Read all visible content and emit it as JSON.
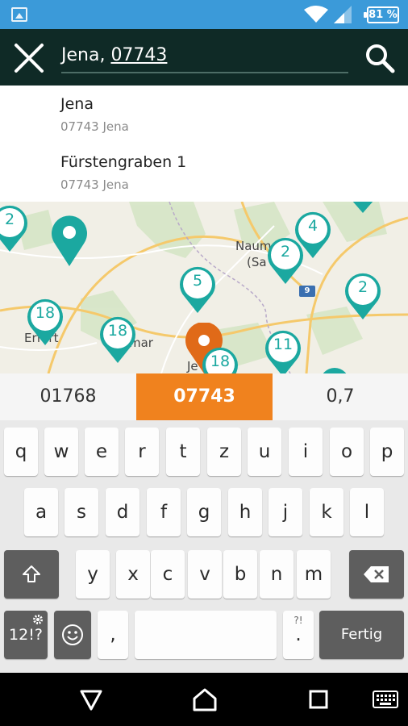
{
  "status_bar": {
    "battery": "81 %"
  },
  "search": {
    "typed": "Jena, ",
    "composing": "07743"
  },
  "suggestions": [
    {
      "title": "Jena",
      "subtitle": "07743 Jena"
    },
    {
      "title": "Fürstengraben 1",
      "subtitle": "07743 Jena"
    }
  ],
  "map": {
    "place_labels": [
      "Naum",
      "(Sa",
      "Erfurt",
      "mar",
      "Je"
    ],
    "road_badge": "9",
    "clusters": [
      "2",
      "4",
      "2",
      "5",
      "2",
      "18",
      "18",
      "18",
      "11"
    ]
  },
  "keyboard": {
    "candidates": [
      "01768",
      "07743",
      "0,7"
    ],
    "row1": [
      "q",
      "w",
      "e",
      "r",
      "t",
      "z",
      "u",
      "i",
      "o",
      "p"
    ],
    "row2": [
      "a",
      "s",
      "d",
      "f",
      "g",
      "h",
      "j",
      "k",
      "l"
    ],
    "row3": [
      "y",
      "x",
      "c",
      "v",
      "b",
      "n",
      "m"
    ],
    "symbols_label": "12!?",
    "comma": ",",
    "period": ".",
    "period_hint": "?!",
    "done_label": "Fertig"
  },
  "colors": {
    "accent": "#f0821e",
    "marker_teal": "#1ba8a0",
    "app_bar": "#0f2a26",
    "status_bar": "#3b9ad9"
  }
}
